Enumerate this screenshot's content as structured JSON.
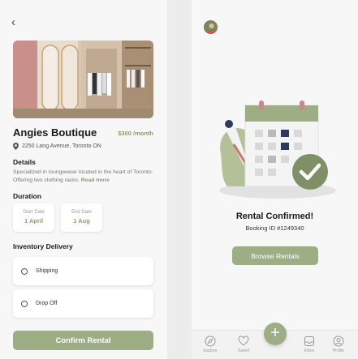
{
  "booking": {
    "back_icon": "chevron-left-icon",
    "shop_name": "Angies Boutique",
    "price": "$300 /month",
    "address": "2250 Lang Avenue, Toronto ON",
    "details_heading": "Details",
    "description": "Specialized in loungewear located in the heart of Toronto. Offering two clothing racks.",
    "read_more": "Read more",
    "duration_heading": "Duration",
    "start_label": "Start Date",
    "start_value": "1 April",
    "end_label": "End Date",
    "end_value": "1 Aug",
    "inventory_heading": "Inventory Delivery",
    "options": [
      "Shipping",
      "Drop Off"
    ],
    "confirm_label": "Confirm Rental"
  },
  "confirmation": {
    "title": "Rental Confirmed!",
    "booking_id": "Booking ID #1249340",
    "browse_label": "Browse Rentals"
  },
  "tabbar": {
    "items": [
      {
        "label": "Explore",
        "icon": "compass-icon"
      },
      {
        "label": "Saved",
        "icon": "heart-icon"
      },
      {
        "label": "Inbox",
        "icon": "inbox-icon"
      },
      {
        "label": "Profile",
        "icon": "user-icon"
      }
    ],
    "fab_icon": "plus-icon"
  },
  "colors": {
    "accent": "#9dae85",
    "accent_text": "#8a9e6e",
    "calendar_dark": "#2d3b5a"
  }
}
